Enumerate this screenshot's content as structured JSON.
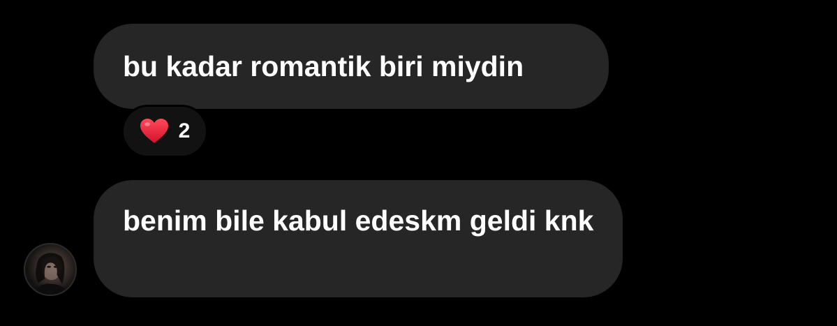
{
  "messages": [
    {
      "text": "bu kadar romantik biri miydin"
    },
    {
      "text": "benim bile kabul edeskm geldi knk"
    }
  ],
  "reaction": {
    "emoji_icon": "heart-icon",
    "count": "2",
    "color": "#e0182d"
  },
  "colors": {
    "background": "#000000",
    "bubble": "#262626",
    "text": "#ffffff"
  },
  "avatar": {
    "icon": "user-avatar-photo"
  }
}
